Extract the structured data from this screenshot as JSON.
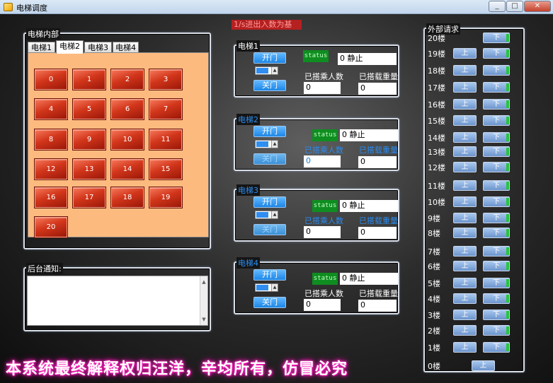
{
  "window": {
    "title": "电梯调度",
    "min": "_",
    "max": "□",
    "close": "✕"
  },
  "colors": {
    "floor_button": "#d2361b",
    "panel_bg": "#fdba7f",
    "status_green": "#0f8d21",
    "elevator_button": "#1d86e6",
    "glow": "#ff2ac0"
  },
  "internal": {
    "title": "电梯内部",
    "tabs": [
      "电梯1",
      "电梯2",
      "电梯3",
      "电梯4"
    ],
    "active_tab": "电梯2",
    "floors": [
      "0",
      "1",
      "2",
      "3",
      "4",
      "5",
      "6",
      "7",
      "8",
      "9",
      "10",
      "11",
      "12",
      "13",
      "14",
      "15",
      "16",
      "17",
      "18",
      "19",
      "20"
    ]
  },
  "notice": {
    "title": "后台通知:",
    "scroll_up": "▲",
    "scroll_down": "▼"
  },
  "header_label": "1/s进出入数为基",
  "elevators": [
    {
      "name": "电梯1",
      "open_label": "开门",
      "close_label": "关门",
      "status_label": "status",
      "status_value": "0  静止",
      "passengers_label": "已搭乘人数",
      "passengers": "0",
      "weight_label": "已搭载重量",
      "weight": "0"
    },
    {
      "name": "电梯2",
      "open_label": "开门",
      "close_label": "关门",
      "status_label": "status",
      "status_value": "0  静止",
      "passengers_label": "已搭乘人数",
      "passengers": "0",
      "weight_label": "已搭载重量",
      "weight": "0"
    },
    {
      "name": "电梯3",
      "open_label": "开门",
      "close_label": "关门",
      "status_label": "status",
      "status_value": "0  静止",
      "passengers_label": "已搭乘人数",
      "passengers": "0",
      "weight_label": "已搭载重量",
      "weight": "0"
    },
    {
      "name": "电梯4",
      "open_label": "开门",
      "close_label": "关门",
      "status_label": "status",
      "status_value": "0  静止",
      "passengers_label": "已搭乘人数",
      "passengers": "0",
      "weight_label": "已搭载重量",
      "weight": "0"
    }
  ],
  "external": {
    "title": "外部请求",
    "up_label": "上",
    "down_label": "下",
    "floors": [
      {
        "label": "20楼",
        "up": false,
        "down": true
      },
      {
        "label": "19楼",
        "up": true,
        "down": true
      },
      {
        "label": "18楼",
        "up": true,
        "down": true
      },
      {
        "label": "17楼",
        "up": true,
        "down": true
      },
      {
        "label": "16楼",
        "up": true,
        "down": true
      },
      {
        "label": "15楼",
        "up": true,
        "down": true
      },
      {
        "label": "14楼",
        "up": true,
        "down": true
      },
      {
        "label": "13楼",
        "up": true,
        "down": true
      },
      {
        "label": "12楼",
        "up": true,
        "down": true
      },
      {
        "label": "11楼",
        "up": true,
        "down": true
      },
      {
        "label": "10楼",
        "up": true,
        "down": true
      },
      {
        "label": "9楼",
        "up": true,
        "down": true
      },
      {
        "label": "8楼",
        "up": true,
        "down": true
      },
      {
        "label": "7楼",
        "up": true,
        "down": true
      },
      {
        "label": "6楼",
        "up": true,
        "down": true
      },
      {
        "label": "5楼",
        "up": true,
        "down": true
      },
      {
        "label": "4楼",
        "up": true,
        "down": true
      },
      {
        "label": "3楼",
        "up": true,
        "down": true
      },
      {
        "label": "2楼",
        "up": true,
        "down": true
      },
      {
        "label": "1楼",
        "up": true,
        "down": true
      },
      {
        "label": "0楼",
        "up": true,
        "down": false
      }
    ]
  },
  "footer_text": "本系统最终解释权归汪洋，辛均所有，仿冒必究"
}
